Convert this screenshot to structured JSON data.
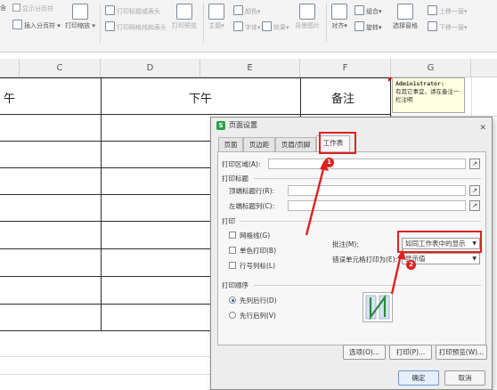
{
  "ribbon": {
    "show_page_break": "显示分页符",
    "insert_page_break": "插入分页符",
    "print_scale": "打印缩放",
    "print_title_or_header": "打印标题或表头",
    "print_gridlines_and_header": "打印网格线和表头",
    "print_preview": "打印预览",
    "theme": "主题",
    "colors": "颜色",
    "fonts": "字体",
    "effects": "效果",
    "background": "背景图片",
    "align": "对齐",
    "group": "组合",
    "rotate": "旋转",
    "selection_pane": "选择窗格",
    "bring_forward": "上移一层",
    "send_backward": "下移一层",
    "row1_left_partial": "含"
  },
  "sheet": {
    "columns": [
      "C",
      "D",
      "E",
      "F",
      "G"
    ],
    "header_left": "午",
    "header_afternoon": "下午",
    "header_remarks": "备注"
  },
  "comment": {
    "author": "Administrator:",
    "text": "有其它事宜，请在备注一栏注明"
  },
  "dialog": {
    "title": "页面设置",
    "icon": "S",
    "tabs": [
      "页面",
      "页边距",
      "页眉/页脚",
      "工作表"
    ],
    "active_tab": "工作表",
    "print_area_label": "打印区域(A):",
    "print_titles_section": "打印标题",
    "rows_to_repeat_label": "顶端标题行(R):",
    "cols_to_repeat_label": "左端标题列(C):",
    "print_section": "打印",
    "gridlines_label": "网格线(G)",
    "single_color_label": "单色打印(B)",
    "row_col_headers_label": "行号列标(L)",
    "comments_label": "批注(M):",
    "comments_value": "如同工作表中的显示",
    "errors_label": "错误单元格打印为(E):",
    "errors_value": "显示值",
    "print_order_section": "打印顺序",
    "down_then_over": "先列后行(D)",
    "over_then_down": "先行后列(V)",
    "options_btn": "选项(O)...",
    "print_btn": "打印(P)...",
    "print_preview_btn": "打印预览(W)...",
    "ok_btn": "确定",
    "cancel_btn": "取消"
  },
  "annotations": {
    "step1": "1",
    "step2": "2"
  },
  "colors": {
    "accent_red": "#e02020",
    "dialog_bg": "#ededed",
    "comment_bg": "#ffffe1"
  }
}
